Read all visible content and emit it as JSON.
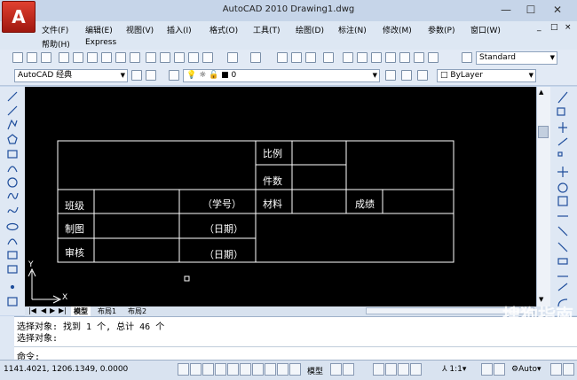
{
  "window": {
    "logo": "A",
    "title": "AutoCAD 2010    Drawing1.dwg",
    "min": "—",
    "max": "☐",
    "close": "✕"
  },
  "menu": {
    "row1": [
      "文件(F)",
      "编辑(E)",
      "视图(V)",
      "插入(I)",
      "格式(O)",
      "工具(T)",
      "绘图(D)",
      "标注(N)",
      "修改(M)",
      "参数(P)",
      "窗口(W)"
    ],
    "row2": [
      "帮助(H)",
      "Express"
    ],
    "doc_controls": [
      "_",
      "□",
      "×"
    ]
  },
  "toolbar": {
    "text_style": "Standard",
    "workspace": "AutoCAD 经典",
    "layer": "0",
    "linetype": "ByLayer"
  },
  "drawing": {
    "table": {
      "ratio": "比例",
      "count": "件数",
      "material": "材料",
      "grade": "成绩",
      "class": "班级",
      "student_no": "（学号）",
      "draw": "制图",
      "date1": "（日期）",
      "review": "审核",
      "date2": "（日期）"
    },
    "ucs_y": "Y",
    "ucs_x": "X"
  },
  "tabs": {
    "nav": [
      "|◀",
      "◀",
      "▶",
      "▶|"
    ],
    "model": "模型",
    "layout1": "布局1",
    "layout2": "布局2"
  },
  "command": {
    "line1": "选择对象: 找到 1 个, 总计 46 个",
    "line2": "选择对象:",
    "prompt": "命令:"
  },
  "status": {
    "coords": "1141.4021,  1206.1349,  0.0000",
    "model": "模型",
    "scale": "1:1",
    "auto": "Auto"
  },
  "watermark": "搜狗指南"
}
